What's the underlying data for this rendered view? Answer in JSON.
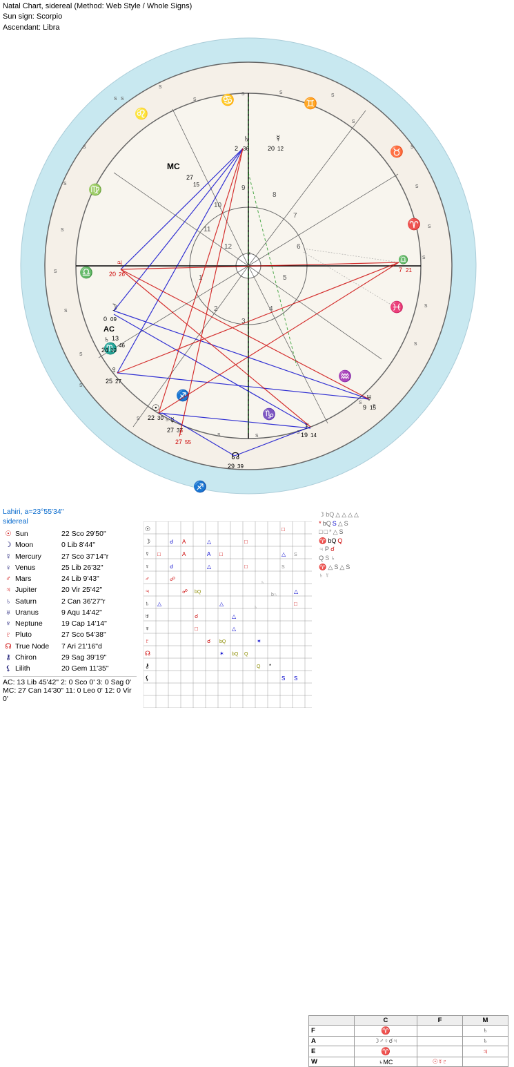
{
  "header": {
    "title": "Natal Chart, sidereal  (Method: Web Style / Whole Signs)",
    "sun_sign": "Sun sign: Scorpio",
    "ascendant": "Ascendant: Libra"
  },
  "lahiri": "Lahiri, a=23°55'34\"",
  "sidereal": "sidereal",
  "planets": [
    {
      "symbol": "☉",
      "name": "Sun",
      "position": "22 Sco 29'50\"",
      "retrograde": false,
      "color": "#cc0000"
    },
    {
      "symbol": "☽",
      "name": "Moon",
      "position": "0 Lib  8'44\"",
      "retrograde": false,
      "color": "#000066"
    },
    {
      "symbol": "☿",
      "name": "Mercury",
      "position": "27 Sco 37'14\"r",
      "retrograde": true,
      "color": "#000066"
    },
    {
      "symbol": "♀",
      "name": "Venus",
      "position": "25 Lib 26'32\"",
      "retrograde": false,
      "color": "#000066"
    },
    {
      "symbol": "♂",
      "name": "Mars",
      "position": "24 Lib  9'43\"",
      "retrograde": false,
      "color": "#cc0000"
    },
    {
      "symbol": "♃",
      "name": "Jupiter",
      "position": "20 Vir 25'42\"",
      "retrograde": false,
      "color": "#cc0000"
    },
    {
      "symbol": "♄",
      "name": "Saturn",
      "position": "2 Can 36'27\"r",
      "retrograde": true,
      "color": "#000066"
    },
    {
      "symbol": "♅",
      "name": "Uranus",
      "position": "9 Aqu 14'42\"",
      "retrograde": false,
      "color": "#000066"
    },
    {
      "symbol": "♆",
      "name": "Neptune",
      "position": "19 Cap 14'14\"",
      "retrograde": false,
      "color": "#000066"
    },
    {
      "symbol": "♇",
      "name": "Pluto",
      "position": "27 Sco 54'38\"",
      "retrograde": false,
      "color": "#cc0000"
    },
    {
      "symbol": "☊",
      "name": "True Node",
      "position": "7 Ari 21'16\"d",
      "retrograde": false,
      "color": "#cc0000"
    },
    {
      "symbol": "⚷",
      "name": "Chiron",
      "position": "29 Sag 39'19\"",
      "retrograde": false,
      "color": "#000066"
    },
    {
      "symbol": "⚸",
      "name": "Lilith",
      "position": "20 Gem 11'35\"",
      "retrograde": false,
      "color": "#000066"
    }
  ],
  "ac_line": "AC: 13 Lib 45'42\"  2: 0 Sco  0'  3: 0 Sag  0'",
  "mc_line": "MC: 27 Can 14'30\"  11: 0 Leo  0'  12: 0 Vir  0'",
  "cfm": {
    "headers": [
      "C",
      "F",
      "M"
    ],
    "rows": [
      {
        "label": "F",
        "c": "♈",
        "f": "",
        "m": "♄"
      },
      {
        "label": "A",
        "c": "☽♂♀☌♃",
        "f": "",
        "m": "♄"
      },
      {
        "label": "E",
        "c": "♈",
        "f": "",
        "m": "♃"
      },
      {
        "label": "W",
        "c": "♄MC",
        "f": "☉☿♇",
        "m": ""
      }
    ]
  }
}
